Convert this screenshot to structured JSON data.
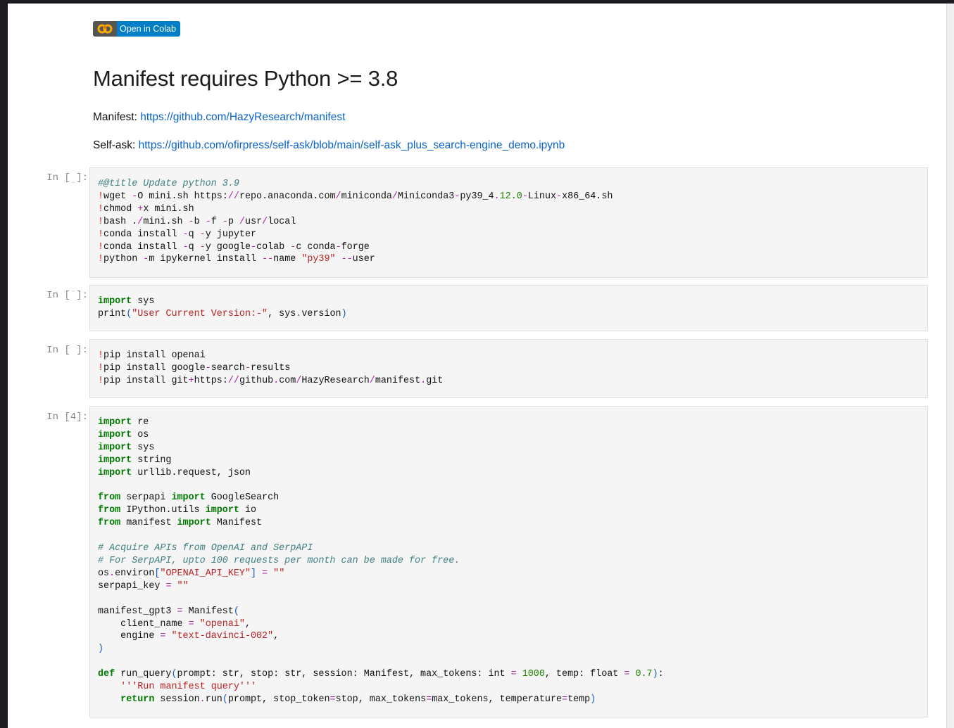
{
  "badge": {
    "label": "Open in Colab",
    "icon": "colab-logo-icon"
  },
  "title": "Manifest requires Python >= 3.8",
  "links": [
    {
      "label": "Manifest:",
      "url": "https://github.com/HazyResearch/manifest"
    },
    {
      "label": "Self-ask:",
      "url": "https://github.com/ofirpress/self-ask/blob/main/self-ask_plus_search-engine_demo.ipynb"
    }
  ],
  "cells": [
    {
      "prompt": "In [ ]:",
      "lines": [
        [
          [
            "cm",
            "#@title Update python 3.9"
          ]
        ],
        [
          [
            "bang",
            "!"
          ],
          [
            "",
            "wget "
          ],
          [
            "op",
            "-"
          ],
          [
            "",
            "O mini.sh https:"
          ],
          [
            "op",
            "//"
          ],
          [
            "",
            "repo.anaconda.com"
          ],
          [
            "op",
            "/"
          ],
          [
            "",
            "miniconda"
          ],
          [
            "op",
            "/"
          ],
          [
            "",
            "Miniconda3"
          ],
          [
            "op",
            "-"
          ],
          [
            "",
            "py39_4"
          ],
          [
            "op",
            "."
          ],
          [
            "nm",
            "12.0"
          ],
          [
            "op",
            "-"
          ],
          [
            "",
            "Linux"
          ],
          [
            "op",
            "-"
          ],
          [
            "",
            "x86_64.sh"
          ]
        ],
        [
          [
            "bang",
            "!"
          ],
          [
            "",
            "chmod "
          ],
          [
            "op",
            "+"
          ],
          [
            "",
            "x mini.sh"
          ]
        ],
        [
          [
            "bang",
            "!"
          ],
          [
            "",
            "bash ."
          ],
          [
            "op",
            "/"
          ],
          [
            "",
            "mini.sh "
          ],
          [
            "op",
            "-"
          ],
          [
            "",
            "b "
          ],
          [
            "op",
            "-"
          ],
          [
            "",
            "f "
          ],
          [
            "op",
            "-"
          ],
          [
            "",
            "p "
          ],
          [
            "op",
            "/"
          ],
          [
            "",
            "usr"
          ],
          [
            "op",
            "/"
          ],
          [
            "",
            "local"
          ]
        ],
        [
          [
            "bang",
            "!"
          ],
          [
            "",
            "conda install "
          ],
          [
            "op",
            "-"
          ],
          [
            "",
            "q "
          ],
          [
            "op",
            "-"
          ],
          [
            "",
            "y jupyter"
          ]
        ],
        [
          [
            "bang",
            "!"
          ],
          [
            "",
            "conda install "
          ],
          [
            "op",
            "-"
          ],
          [
            "",
            "q "
          ],
          [
            "op",
            "-"
          ],
          [
            "",
            "y google"
          ],
          [
            "op",
            "-"
          ],
          [
            "",
            "colab "
          ],
          [
            "op",
            "-"
          ],
          [
            "",
            "c conda"
          ],
          [
            "op",
            "-"
          ],
          [
            "",
            "forge"
          ]
        ],
        [
          [
            "bang",
            "!"
          ],
          [
            "",
            "python "
          ],
          [
            "op",
            "-"
          ],
          [
            "",
            "m ipykernel install "
          ],
          [
            "op",
            "--"
          ],
          [
            "",
            "name "
          ],
          [
            "st",
            "\"py39\""
          ],
          [
            "",
            ""
          ],
          [
            "op",
            " --"
          ],
          [
            "",
            "user"
          ]
        ]
      ]
    },
    {
      "prompt": "In [ ]:",
      "lines": [
        [
          [
            "kw",
            "import"
          ],
          [
            "",
            " sys"
          ]
        ],
        [
          [
            "",
            "print"
          ],
          [
            "pu",
            "("
          ],
          [
            "st",
            "\"User Current Version:-\""
          ],
          [
            "",
            ", sys"
          ],
          [
            "op",
            "."
          ],
          [
            "",
            "version"
          ],
          [
            "pu",
            ")"
          ]
        ]
      ]
    },
    {
      "prompt": "In [ ]:",
      "lines": [
        [
          [
            "bang",
            "!"
          ],
          [
            "",
            "pip install openai"
          ]
        ],
        [
          [
            "bang",
            "!"
          ],
          [
            "",
            "pip install google"
          ],
          [
            "op",
            "-"
          ],
          [
            "",
            "search"
          ],
          [
            "op",
            "-"
          ],
          [
            "",
            "results"
          ]
        ],
        [
          [
            "bang",
            "!"
          ],
          [
            "",
            "pip install git"
          ],
          [
            "op",
            "+"
          ],
          [
            "",
            "https:"
          ],
          [
            "op",
            "//"
          ],
          [
            "",
            "github"
          ],
          [
            "op",
            "."
          ],
          [
            "",
            "com"
          ],
          [
            "op",
            "/"
          ],
          [
            "",
            "HazyResearch"
          ],
          [
            "op",
            "/"
          ],
          [
            "",
            "manifest"
          ],
          [
            "op",
            "."
          ],
          [
            "",
            "git"
          ]
        ]
      ]
    },
    {
      "prompt": "In [4]:",
      "lines": [
        [
          [
            "kw",
            "import"
          ],
          [
            "",
            " re"
          ]
        ],
        [
          [
            "kw",
            "import"
          ],
          [
            "",
            " os"
          ]
        ],
        [
          [
            "kw",
            "import"
          ],
          [
            "",
            " sys"
          ]
        ],
        [
          [
            "kw",
            "import"
          ],
          [
            "",
            " string"
          ]
        ],
        [
          [
            "kw",
            "import"
          ],
          [
            "",
            " urllib.request, json"
          ]
        ],
        [],
        [
          [
            "kw",
            "from"
          ],
          [
            "",
            " serpapi "
          ],
          [
            "kw",
            "import"
          ],
          [
            "",
            " GoogleSearch"
          ]
        ],
        [
          [
            "kw",
            "from"
          ],
          [
            "",
            " IPython.utils "
          ],
          [
            "kw",
            "import"
          ],
          [
            "",
            " io"
          ]
        ],
        [
          [
            "kw",
            "from"
          ],
          [
            "",
            " manifest "
          ],
          [
            "kw",
            "import"
          ],
          [
            "",
            " Manifest"
          ]
        ],
        [],
        [
          [
            "cm",
            "# Acquire APIs from OpenAI and SerpAPI"
          ]
        ],
        [
          [
            "cm",
            "# For SerpAPI, upto 100 requests per month can be made for free."
          ]
        ],
        [
          [
            "",
            "os"
          ],
          [
            "op",
            "."
          ],
          [
            "",
            "environ"
          ],
          [
            "pu",
            "["
          ],
          [
            "st",
            "\"OPENAI_API_KEY\""
          ],
          [
            "pu",
            "]"
          ],
          [
            "op",
            " ="
          ],
          [
            "st",
            " \"\""
          ]
        ],
        [
          [
            "",
            "serpapi_key "
          ],
          [
            "op",
            "="
          ],
          [
            "st",
            " \"\""
          ]
        ],
        [],
        [
          [
            "",
            "manifest_gpt3 "
          ],
          [
            "op",
            "="
          ],
          [
            "",
            " Manifest"
          ],
          [
            "pu",
            "("
          ]
        ],
        [
          [
            "",
            "    client_name "
          ],
          [
            "op",
            "="
          ],
          [
            "st",
            " \"openai\""
          ],
          [
            "",
            ","
          ]
        ],
        [
          [
            "",
            "    engine "
          ],
          [
            "op",
            "="
          ],
          [
            "st",
            " \"text-davinci-002\""
          ],
          [
            "",
            ","
          ]
        ],
        [
          [
            "pu",
            ")"
          ]
        ],
        [],
        [
          [
            "kw",
            "def"
          ],
          [
            "",
            " run_query"
          ],
          [
            "pu",
            "("
          ],
          [
            "",
            "prompt: str, stop: str, session: Manifest, max_tokens: int "
          ],
          [
            "op",
            "="
          ],
          [
            "nm",
            " 1000"
          ],
          [
            "",
            ", temp: float "
          ],
          [
            "op",
            "="
          ],
          [
            "nm",
            " 0.7"
          ],
          [
            "pu",
            ")"
          ],
          [
            "",
            ":"
          ]
        ],
        [
          [
            "",
            "    "
          ],
          [
            "st",
            "'''Run manifest query'''"
          ]
        ],
        [
          [
            "",
            "    "
          ],
          [
            "kw",
            "return"
          ],
          [
            "",
            " session"
          ],
          [
            "op",
            "."
          ],
          [
            "",
            "run"
          ],
          [
            "pu",
            "("
          ],
          [
            "",
            "prompt, stop_token"
          ],
          [
            "op",
            "="
          ],
          [
            "",
            "stop, max_tokens"
          ],
          [
            "op",
            "="
          ],
          [
            "",
            "max_tokens, temperature"
          ],
          [
            "op",
            "="
          ],
          [
            "",
            "temp"
          ],
          [
            "pu",
            ")"
          ]
        ]
      ]
    }
  ]
}
